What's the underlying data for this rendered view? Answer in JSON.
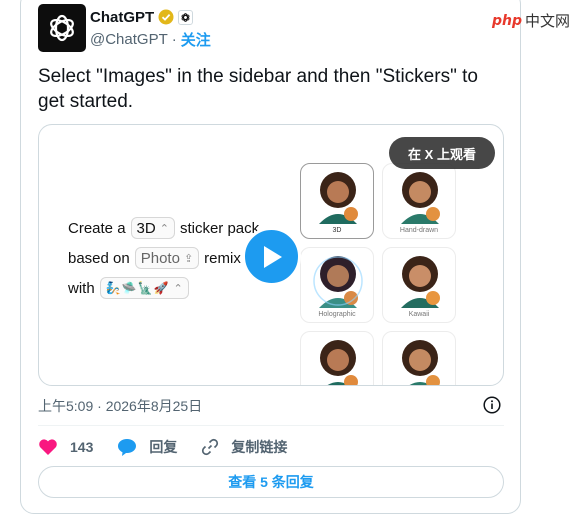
{
  "account": {
    "name": "ChatGPT",
    "handle": "@ChatGPT",
    "separator": "·",
    "follow_label": "关注"
  },
  "watermark": {
    "php": "php",
    "site": "中文网"
  },
  "tweet_text": "Select \"Images\" in the sidebar and then \"Stickers\" to get started.",
  "media": {
    "watch_on_x_label": "在 X 上观看",
    "prompt": {
      "line1_pre": "Create a",
      "style_value": "3D",
      "line1_post": "sticker pack",
      "line2_pre": "based on",
      "photo_value": "Photo",
      "line2_post": "remix",
      "line3_pre": "with",
      "emoji_value": "🧞🛸🗽🚀"
    },
    "styles": [
      "3D",
      "Hand-drawn",
      "Holographic",
      "Kawaii"
    ]
  },
  "meta": {
    "time": "上午5:09",
    "sep": "·",
    "date": "2026年8月25日"
  },
  "actions": {
    "likes": "143",
    "reply_label": "回复",
    "copy_link_label": "复制链接"
  },
  "view_replies_label": "查看 5 条回复",
  "colors": {
    "accent": "#1d9bf0",
    "like": "#f91880",
    "verified": "#e2b719"
  }
}
